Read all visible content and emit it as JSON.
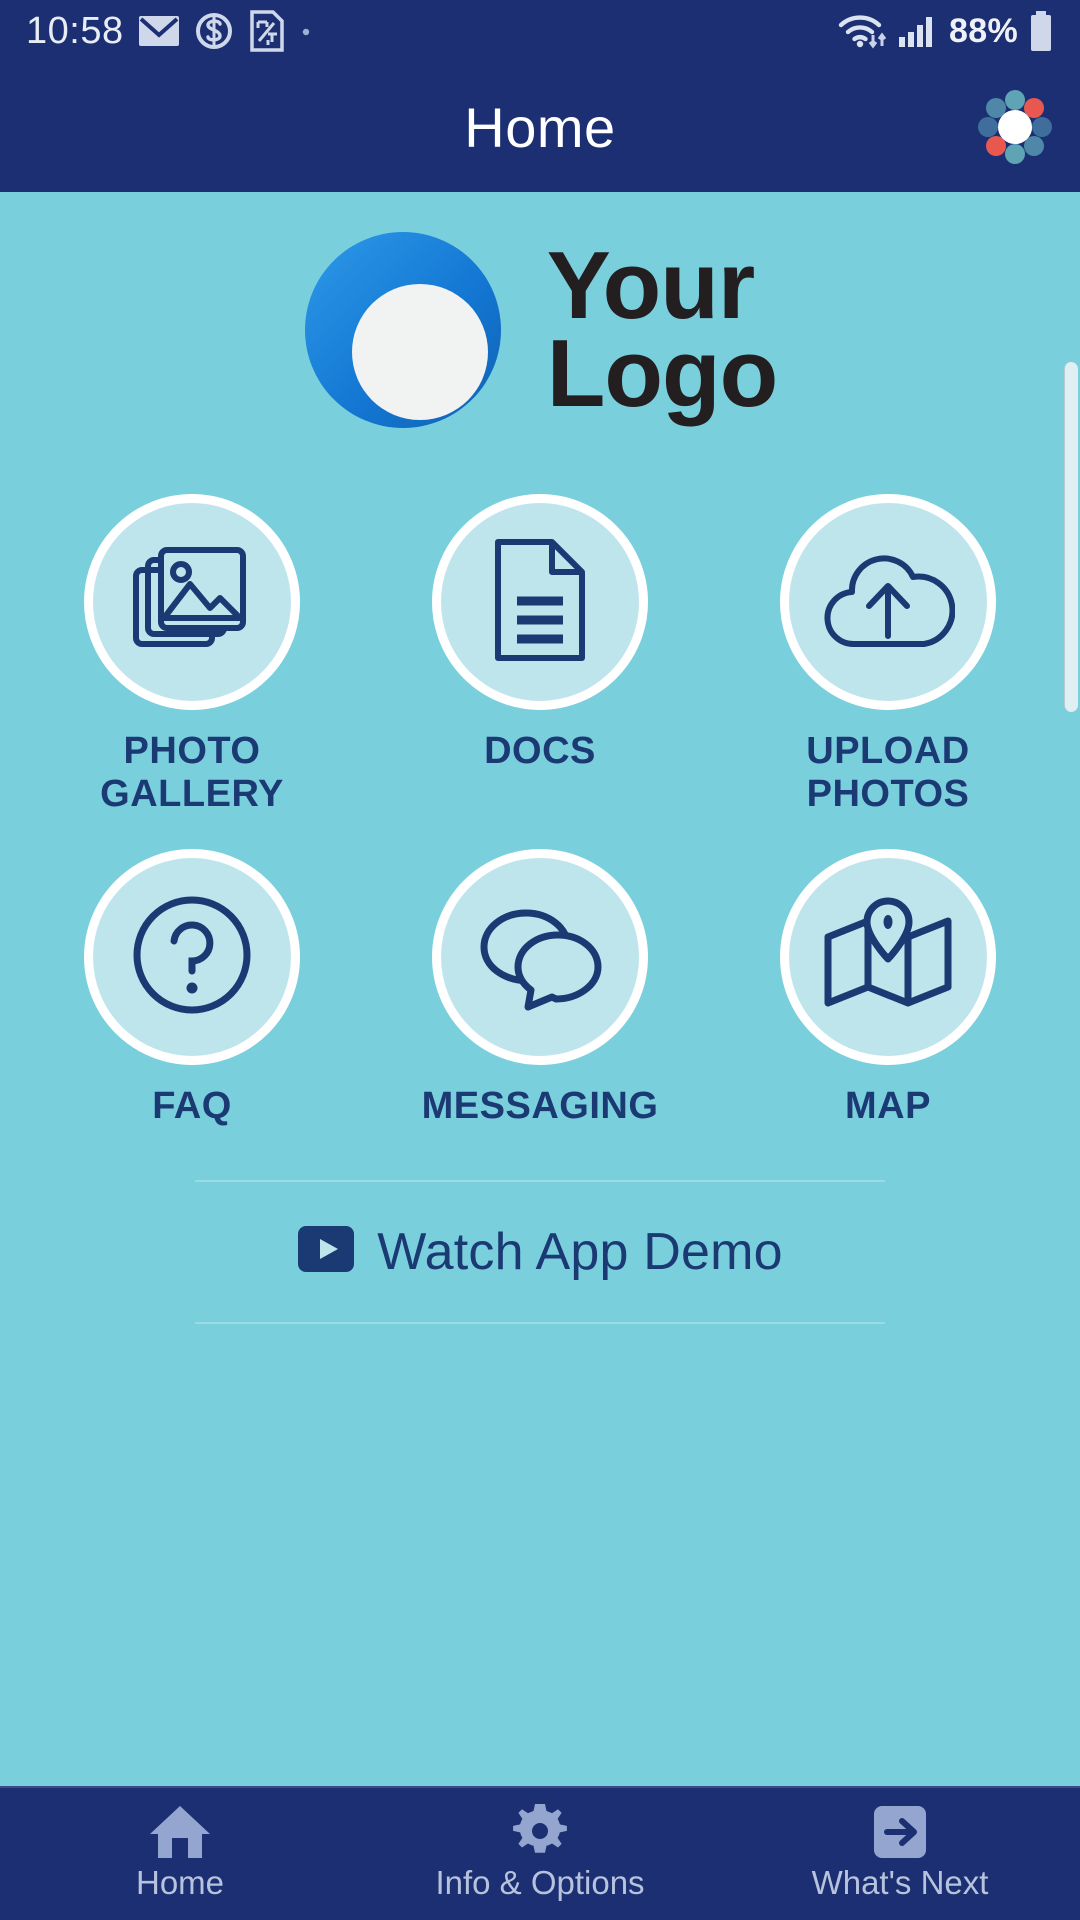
{
  "statusbar": {
    "time": "10:58",
    "battery_percent": "88%",
    "icons": [
      "mail-icon",
      "circle-s-icon",
      "sim-card-icon",
      "dot-icon",
      "wifi-icon",
      "cellular-signal-icon",
      "battery-icon"
    ]
  },
  "header": {
    "title": "Home",
    "app_badge_name": "app-logo-dots-badge"
  },
  "brand": {
    "line1": "Your",
    "line2": "Logo",
    "mark_name": "your-logo-circle-mark"
  },
  "tiles": [
    {
      "label": "PHOTO\nGALLERY",
      "label_line1": "PHOTO",
      "label_line2": "GALLERY",
      "icon": "photo-gallery-icon"
    },
    {
      "label": "DOCS",
      "label_line1": "DOCS",
      "label_line2": "",
      "icon": "document-icon"
    },
    {
      "label": "UPLOAD\nPHOTOS",
      "label_line1": "UPLOAD",
      "label_line2": "PHOTOS",
      "icon": "cloud-upload-icon"
    },
    {
      "label": "FAQ",
      "label_line1": "FAQ",
      "label_line2": "",
      "icon": "question-mark-circle-icon"
    },
    {
      "label": "MESSAGING",
      "label_line1": "MESSAGING",
      "label_line2": "",
      "icon": "speech-bubbles-icon"
    },
    {
      "label": "MAP",
      "label_line1": "MAP",
      "label_line2": "",
      "icon": "folded-map-pin-icon"
    }
  ],
  "demo": {
    "label": "Watch App Demo",
    "icon": "play-button-icon"
  },
  "bottomnav": [
    {
      "label": "Home",
      "icon": "house-icon"
    },
    {
      "label": "Info & Options",
      "icon": "gear-icon"
    },
    {
      "label": "What's Next",
      "icon": "arrow-right-box-icon"
    }
  ],
  "colors": {
    "navy": "#1b2f72",
    "page_bg": "#7acfdd",
    "tile_fill": "#bfe5ec",
    "tile_ring": "#ffffff",
    "label_navy": "#1b3a73",
    "brand_blue": "#1478d4",
    "accent_red": "#e8584f",
    "accent_teal": "#6aa9bd"
  }
}
